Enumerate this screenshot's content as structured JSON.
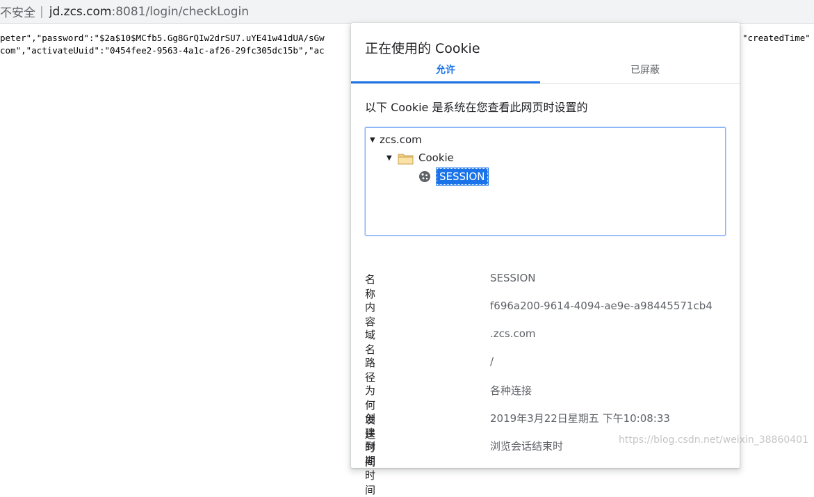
{
  "address_bar": {
    "security": "不安全",
    "separator": "|",
    "host": "jd.zcs.com",
    "path": ":8081/login/checkLogin"
  },
  "page": {
    "line1_left": "peter\",\"password\":\"$2a$10$MCfb5.Gg8GrQIw2drSU7.uYE41w41dUA/sGw",
    "line1_right": "\"createdTime\"",
    "line2_left": "com\",\"activateUuid\":\"0454fee2-9563-4a1c-af26-29fc305dc15b\",\"ac"
  },
  "dialog": {
    "title": "正在使用的 Cookie",
    "tabs": [
      {
        "label": "允许",
        "active": true
      },
      {
        "label": "已屏蔽",
        "active": false
      }
    ],
    "subtitle": "以下 Cookie 是系统在您查看此网页时设置的",
    "tree": {
      "domain": "zcs.com",
      "folder": "Cookie",
      "selected_cookie": "SESSION"
    },
    "details": [
      {
        "key": "名称",
        "value": "SESSION"
      },
      {
        "key": "内容",
        "value": "f696a200-9614-4094-ae9e-a98445571cb4"
      },
      {
        "key": "域名",
        "value": ".zcs.com"
      },
      {
        "key": "路径",
        "value": "/"
      },
      {
        "key": "为何发送",
        "value": "各种连接"
      },
      {
        "key": "创建时间",
        "value": "2019年3月22日星期五 下午10:08:33"
      },
      {
        "key": "到期时间",
        "value": "浏览会话结束时"
      }
    ]
  },
  "watermark": "https://blog.csdn.net/weixin_38860401",
  "colors": {
    "accent": "#1a73e8",
    "selection": "#1a73e8"
  }
}
